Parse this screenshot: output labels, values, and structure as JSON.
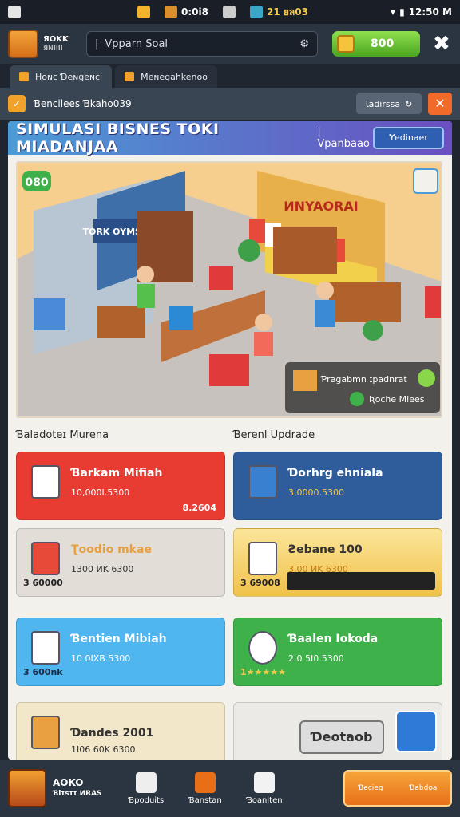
{
  "status": {
    "a": "0:0i8",
    "b": "21 ยล03",
    "time": "12:50 M"
  },
  "topbar": {
    "logo_line1": "ЯOKK",
    "logo_line2": "ЯNIIII",
    "url": "Vpparn Soal",
    "coins": "800"
  },
  "tabs": [
    {
      "label": "Hoɴc Ɗeɴgeɴcl"
    },
    {
      "label": "Meɴegahkenoo"
    }
  ],
  "addressbar": {
    "text": "Ɓencilees Ɓkaho039",
    "button": "Ɩadirssa"
  },
  "header": {
    "title": "SIMULASI BISNES TOKI MIADANJAA",
    "subtitle": "| Vpanbaao",
    "button": "Ɏedinaer"
  },
  "scene": {
    "badge": "080",
    "signs": [
      "TORK OYMSUDAL",
      "ИNYAORAI"
    ],
    "overlay_line1": "Ƥragabmn ɪpadnrat",
    "overlay_line2": "Ʀoche Miees"
  },
  "sections": {
    "left": "Ɓaladoteɪ Murena",
    "right": "Ɓerenl Updrade"
  },
  "cards": [
    {
      "name": "Ɓarkam Mifiah",
      "price": "10,000I.5300",
      "extra": "8.2604",
      "color": "#e83c32",
      "icon": "shop-icon"
    },
    {
      "name": "Ɗorhrg ehniala",
      "price": "3,0000.5300",
      "extra": "",
      "color": "#2f5d9c",
      "icon": "phone-icon"
    },
    {
      "name": "Ʈoodio mkae",
      "price": "1300 ИK 6300",
      "extra": "3 60000",
      "color": "#e2ddd6",
      "icon": "calendar-icon"
    },
    {
      "name": "Ƨebane 100",
      "price": "3,00 ИK 6300",
      "extra": "3 69008",
      "color": "#f7d77b",
      "icon": "book-icon"
    },
    {
      "name": "Ɓentien Mibiah",
      "price": "10 0IXB.5300",
      "extra": "3 600nk",
      "color": "#4fb6ef",
      "icon": "card-icon"
    },
    {
      "name": "Ɓaalen Iokoda",
      "price": "2.0 5I0.5300",
      "extra": "1★★★★★",
      "color": "#3fb14a",
      "icon": "ball-icon"
    },
    {
      "name": "Ɗandes 2001",
      "price": "1I06 60K 6300",
      "extra": "",
      "color": "#f2e7c8",
      "icon": "box-icon"
    },
    {
      "name": "Ɗeotaob",
      "price": "",
      "extra": "",
      "color": "#eceae6",
      "icon": "ticket-icon"
    }
  ],
  "bottomnav": {
    "brand1": "AOKO",
    "brand2": "Ɓiɪsɪɪ ИRAS",
    "items": [
      {
        "label": "Ɓpoduits"
      },
      {
        "label": "Ɓanstan"
      },
      {
        "label": "Ɓoaniten"
      }
    ],
    "cta_left": "Ɓecieg",
    "cta_right": "Ɓabdoa"
  }
}
